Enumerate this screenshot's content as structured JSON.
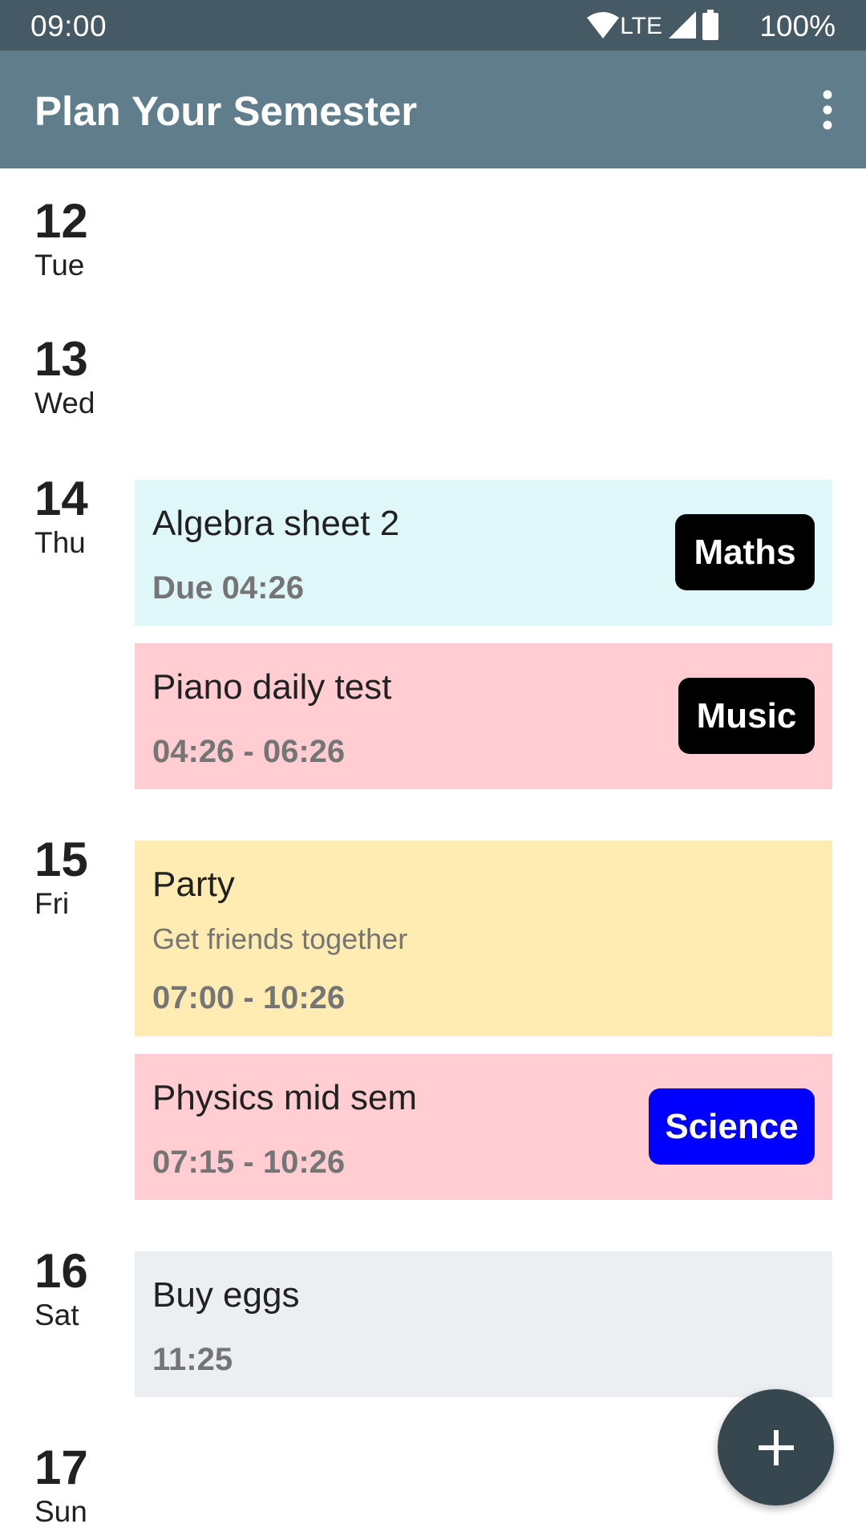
{
  "status_bar": {
    "time": "09:00",
    "network": "LTE",
    "battery": "100%",
    "icons": [
      "wifi-icon",
      "signal-icon",
      "battery-icon"
    ]
  },
  "app_bar": {
    "title": "Plan Your Semester",
    "menu_icon": "more-vert-icon"
  },
  "days": [
    {
      "num": "12",
      "name": "Tue"
    },
    {
      "num": "13",
      "name": "Wed"
    },
    {
      "num": "14",
      "name": "Thu"
    },
    {
      "num": "15",
      "name": "Fri"
    },
    {
      "num": "16",
      "name": "Sat"
    },
    {
      "num": "17",
      "name": "Sun"
    }
  ],
  "events": [
    {
      "title": "Algebra sheet 2",
      "time": "Due 04:26",
      "tag": "Maths",
      "bg": "#e0f7fa",
      "tag_color": "#000000"
    },
    {
      "title": "Piano daily test",
      "time": "04:26 - 06:26",
      "tag": "Music",
      "bg": "#ffcdd2",
      "tag_color": "#000000"
    },
    {
      "title": "Party",
      "subtitle": "Get friends together",
      "time": "07:00 - 10:26",
      "bg": "#ffecb3"
    },
    {
      "title": "Physics mid sem",
      "time": "07:15 - 10:26",
      "tag": "Science",
      "bg": "#ffcdd2",
      "tag_color": "#0000ff"
    },
    {
      "title": "Buy eggs",
      "time": "11:25",
      "bg": "#eceff1"
    }
  ],
  "fab": {
    "icon": "plus-icon"
  },
  "colors": {
    "status_bar": "#455a64",
    "app_bar": "#607d8b",
    "fab": "#37474f"
  }
}
